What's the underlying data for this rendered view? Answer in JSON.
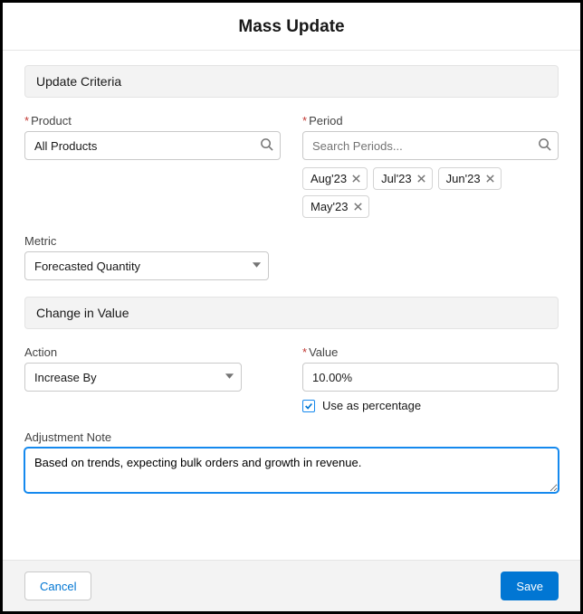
{
  "dialog": {
    "title": "Mass Update"
  },
  "updateCriteria": {
    "header": "Update Criteria",
    "product": {
      "label": "Product",
      "value": "All Products"
    },
    "period": {
      "label": "Period",
      "placeholder": "Search Periods...",
      "chips": [
        "Aug'23",
        "Jul'23",
        "Jun'23",
        "May'23"
      ]
    },
    "metric": {
      "label": "Metric",
      "value": "Forecasted Quantity"
    }
  },
  "changeInValue": {
    "header": "Change in Value",
    "action": {
      "label": "Action",
      "value": "Increase By"
    },
    "value": {
      "label": "Value",
      "value": "10.00%"
    },
    "useAsPercentage": {
      "label": "Use as percentage",
      "checked": true
    }
  },
  "adjustmentNote": {
    "label": "Adjustment Note",
    "value": "Based on trends, expecting bulk orders and growth in revenue."
  },
  "footer": {
    "cancel": "Cancel",
    "save": "Save"
  }
}
